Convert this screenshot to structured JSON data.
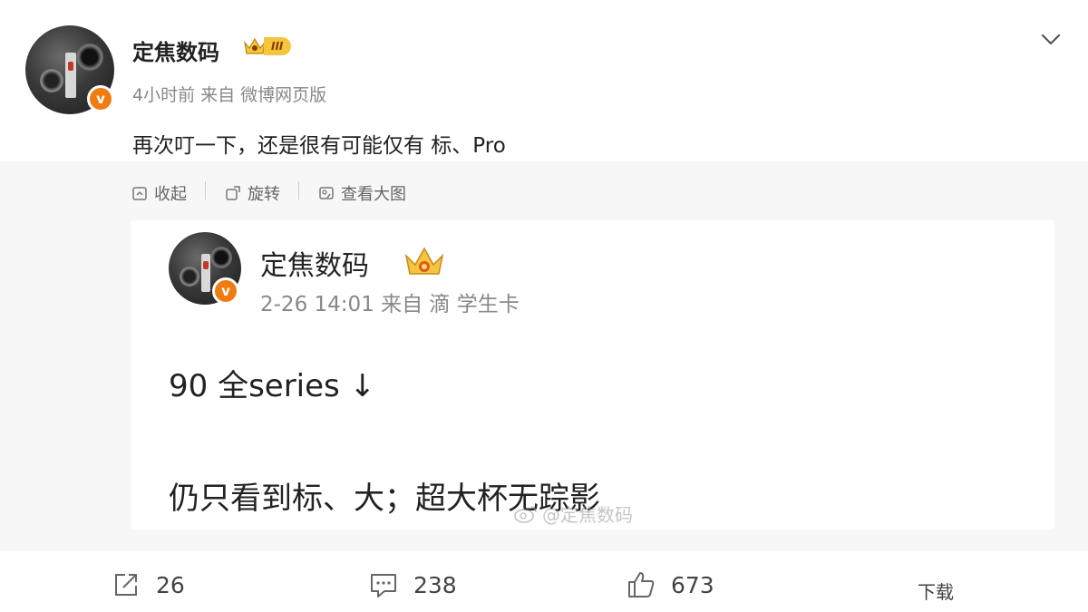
{
  "post": {
    "username": "定焦数码",
    "vip_level": "III",
    "meta": "4小时前  来自 微博网页版",
    "text": "再次叮一下，还是很有可能仅有 标、Pro",
    "verified_badge": "v"
  },
  "toolbar": {
    "collapse_label": "收起",
    "rotate_label": "旋转",
    "view_large_label": "查看大图"
  },
  "quoted_post": {
    "username": "定焦数码",
    "meta": "2-26 14:01 来自 滴 学生卡",
    "line1": "90 全series ↓",
    "line2": "仍只看到标、大；超大杯无踪影",
    "verified_badge": "v",
    "watermark": "@定焦数码"
  },
  "footer": {
    "repost_count": "26",
    "comment_count": "238",
    "like_count": "673",
    "download_label": "下载"
  },
  "colors": {
    "accent_orange": "#f07b10",
    "crown_gold": "#f4c53d",
    "meta_gray": "#888888",
    "repost_bg": "#f7f7f7"
  },
  "icons": [
    "chevron-down-icon",
    "crown-icon",
    "collapse-icon",
    "rotate-icon",
    "view-image-icon",
    "weibo-logo-icon",
    "repost-icon",
    "comment-icon",
    "like-icon"
  ]
}
